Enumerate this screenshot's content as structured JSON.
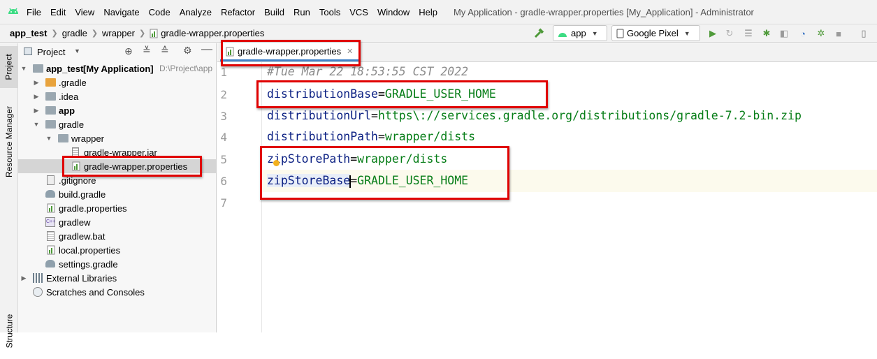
{
  "menubar": {
    "items": [
      "File",
      "Edit",
      "View",
      "Navigate",
      "Code",
      "Analyze",
      "Refactor",
      "Build",
      "Run",
      "Tools",
      "VCS",
      "Window",
      "Help"
    ],
    "window_title": "My Application - gradle-wrapper.properties [My_Application] - Administrator"
  },
  "navbar": {
    "breadcrumbs": [
      "app_test",
      "gradle",
      "wrapper",
      "gradle-wrapper.properties"
    ],
    "run_config": "app",
    "device": "Google Pixel"
  },
  "stripe": {
    "project_tab": "Project",
    "resource_manager_tab": "Resource Manager",
    "structure_tab": "Structure"
  },
  "project_panel": {
    "view_mode": "Project",
    "root": {
      "name": "app_test",
      "module": "[My Application]",
      "path": "D:\\Project\\app"
    },
    "items": [
      {
        "label": ".gradle"
      },
      {
        "label": ".idea"
      },
      {
        "label": "app"
      },
      {
        "label": "gradle"
      },
      {
        "label": "wrapper"
      },
      {
        "label": "gradle-wrapper.jar"
      },
      {
        "label": "gradle-wrapper.properties"
      },
      {
        "label": ".gitignore"
      },
      {
        "label": "build.gradle"
      },
      {
        "label": "gradle.properties"
      },
      {
        "label": "gradlew"
      },
      {
        "label": "gradlew.bat"
      },
      {
        "label": "local.properties"
      },
      {
        "label": "settings.gradle"
      },
      {
        "label": "External Libraries"
      },
      {
        "label": "Scratches and Consoles"
      }
    ]
  },
  "editor": {
    "tab_label": "gradle-wrapper.properties",
    "line_numbers": [
      "1",
      "2",
      "3",
      "4",
      "5",
      "6",
      "7"
    ],
    "lines": [
      {
        "comment": "#Tue Mar 22 18:53:55 CST 2022"
      },
      {
        "key": "distributionBase",
        "eq": "=",
        "value": "GRADLE_USER_HOME"
      },
      {
        "key": "distributionUrl",
        "eq": "=",
        "value": "https\\://services.gradle.org/distributions/gradle-7.2-bin.zip"
      },
      {
        "key": "distributionPath",
        "eq": "=",
        "value": "wrapper/dists"
      },
      {
        "key": "zipStorePath",
        "eq": "=",
        "value": "wrapper/dists"
      },
      {
        "key": "zipStoreBase",
        "eq": "=",
        "value": "GRADLE_USER_HOME"
      },
      {}
    ]
  },
  "colors": {
    "highlight_box": "#e00000",
    "key_color": "#0a1f82",
    "value_color": "#067d17",
    "comment_color": "#8c8c8c"
  }
}
